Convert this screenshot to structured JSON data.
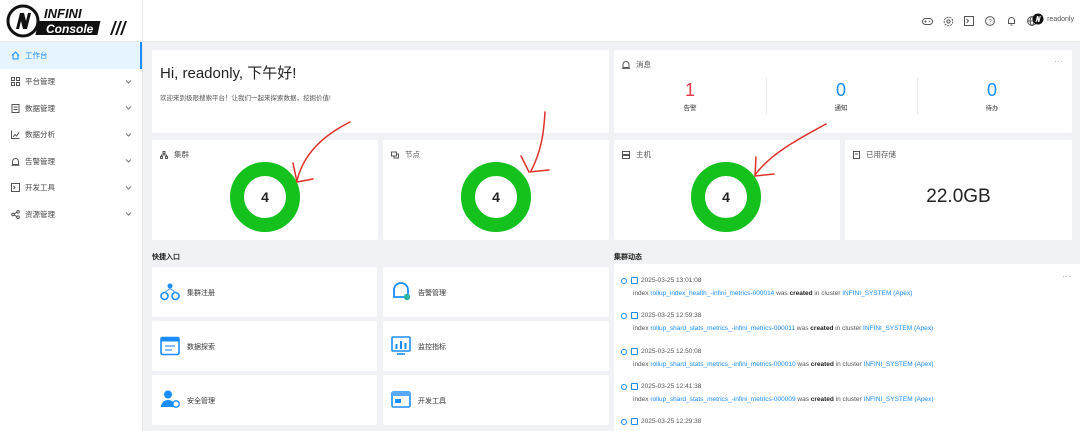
{
  "brand": {
    "name_top": "INFINI",
    "name_bottom": "Console"
  },
  "topbar": {
    "icons": [
      "gamepad-icon",
      "settings-gear-icon",
      "terminal-icon",
      "help-icon",
      "bell-icon",
      "globe-icon"
    ],
    "user": "readonly"
  },
  "sidebar": {
    "items": [
      {
        "label": "工作台",
        "icon": "home-icon",
        "active": true,
        "expandable": false
      },
      {
        "label": "平台管理",
        "icon": "platform-icon",
        "active": false,
        "expandable": true
      },
      {
        "label": "数据管理",
        "icon": "data-icon",
        "active": false,
        "expandable": true
      },
      {
        "label": "数据分析",
        "icon": "chart-icon",
        "active": false,
        "expandable": true
      },
      {
        "label": "告警管理",
        "icon": "alert-icon",
        "active": false,
        "expandable": true
      },
      {
        "label": "开发工具",
        "icon": "devtools-icon",
        "active": false,
        "expandable": true
      },
      {
        "label": "资源管理",
        "icon": "share-icon",
        "active": false,
        "expandable": true
      }
    ]
  },
  "greeting": {
    "title": "Hi, readonly, 下午好!",
    "subtitle": "欢迎来到极限搜索平台！让我们一起来探索数据，挖掘价值!"
  },
  "messages": {
    "title": "消息",
    "more": "...",
    "items": [
      {
        "value": "1",
        "label": "告警",
        "color": "#e8384f"
      },
      {
        "value": "0",
        "label": "通知",
        "color": "#1a8dff"
      },
      {
        "value": "0",
        "label": "待办",
        "color": "#1a8dff"
      }
    ]
  },
  "stats": {
    "cluster": {
      "title": "集群",
      "value": "4"
    },
    "node": {
      "title": "节点",
      "value": "4"
    },
    "host": {
      "title": "主机",
      "value": "4"
    },
    "storage": {
      "title": "已用存储",
      "value": "22.0GB"
    }
  },
  "quick_entry": {
    "title": "快捷入口",
    "items": [
      {
        "label": "集群注册"
      },
      {
        "label": "告警管理"
      },
      {
        "label": "数据探索"
      },
      {
        "label": "监控指标"
      },
      {
        "label": "安全管理"
      },
      {
        "label": "开发工具"
      }
    ]
  },
  "activity": {
    "title": "集群动态",
    "more": "...",
    "items": [
      {
        "time": "2025-03-25 13:01:08",
        "prefix": "index ",
        "index": "rollup_index_health_-infini_metrics-000014",
        "mid": " was ",
        "action": "created",
        "tail": " in cluster ",
        "cluster": "INFINI_SYSTEM (Apex)"
      },
      {
        "time": "2025-03-25 12:59:38",
        "prefix": "index ",
        "index": "rollup_shard_stats_metrics_-infini_metrics-000011",
        "mid": " was ",
        "action": "created",
        "tail": " in cluster ",
        "cluster": "INFINI_SYSTEM (Apex)"
      },
      {
        "time": "2025-03-25 12:50:08",
        "prefix": "index ",
        "index": "rollup_shard_stats_metrics_-infini_metrics-000010",
        "mid": " was ",
        "action": "created",
        "tail": " in cluster ",
        "cluster": "INFINI_SYSTEM (Apex)"
      },
      {
        "time": "2025-03-25 12:41:38",
        "prefix": "index ",
        "index": "rollup_shard_stats_metrics_-infini_metrics-000009",
        "mid": " was ",
        "action": "created",
        "tail": " in cluster ",
        "cluster": "INFINI_SYSTEM (Apex)"
      },
      {
        "time": "2025-03-25 12:29:38"
      }
    ]
  },
  "colors": {
    "accent": "#1a8dff",
    "ring": "#14c11d",
    "alert": "#e8384f",
    "annotation": "#e0302a"
  }
}
